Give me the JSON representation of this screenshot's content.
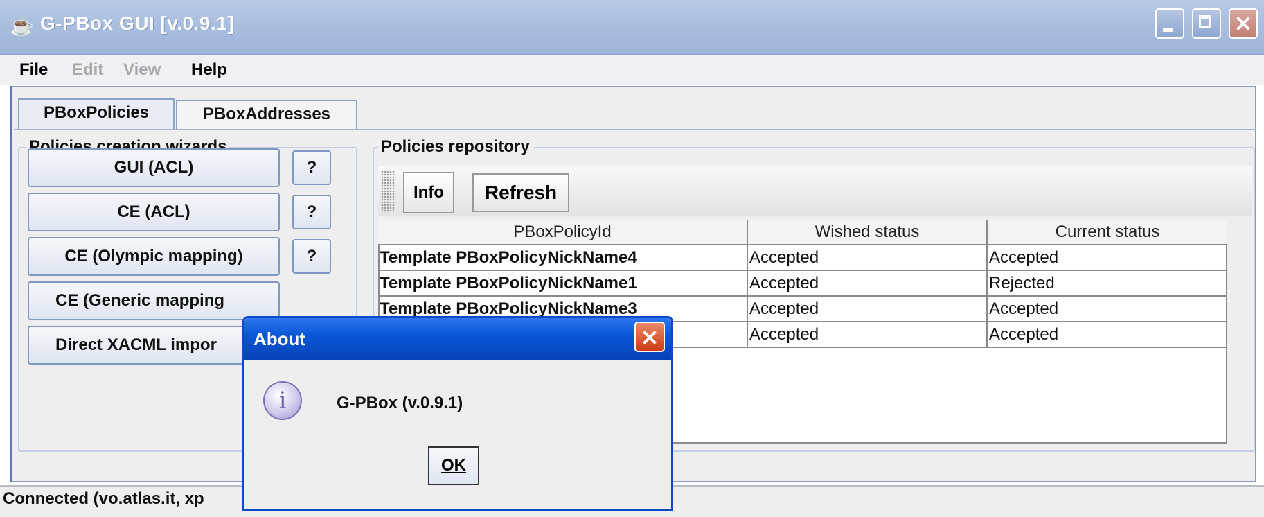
{
  "window": {
    "title": "G-PBox GUI [v.0.9.1]",
    "icon": "java-cup-icon"
  },
  "menubar": {
    "items": [
      {
        "label": "File",
        "enabled": true
      },
      {
        "label": "Edit",
        "enabled": false
      },
      {
        "label": "View",
        "enabled": false
      },
      {
        "label": "Help",
        "enabled": true
      }
    ]
  },
  "tabs": [
    {
      "label": "PBoxPolicies",
      "selected": true
    },
    {
      "label": "PBoxAddresses",
      "selected": false
    }
  ],
  "wizards": {
    "title": "Policies creation wizards",
    "buttons": [
      {
        "label": "GUI (ACL)",
        "help": "?"
      },
      {
        "label": "CE (ACL)",
        "help": "?"
      },
      {
        "label": "CE (Olympic mapping)",
        "help": "?"
      },
      {
        "label": "CE (Generic mapping",
        "help": ""
      },
      {
        "label": "Direct XACML impor",
        "help": ""
      }
    ]
  },
  "repository": {
    "title": "Policies repository",
    "toolbar": {
      "info": "Info",
      "refresh": "Refresh"
    },
    "columns": [
      "PBoxPolicyId",
      "Wished status",
      "Current status"
    ],
    "rows": [
      [
        "Template PBoxPolicyNickName4",
        "Accepted",
        "Accepted"
      ],
      [
        "Template PBoxPolicyNickName1",
        "Accepted",
        "Rejected"
      ],
      [
        "Template PBoxPolicyNickName3",
        "Accepted",
        "Accepted"
      ],
      [
        "",
        "Accepted",
        "Accepted"
      ]
    ]
  },
  "status": {
    "text": "Connected (vo.atlas.it, xp"
  },
  "dialog": {
    "title": "About",
    "message": "G-PBox (v.0.9.1)",
    "icon": "info-icon",
    "ok": "OK"
  }
}
